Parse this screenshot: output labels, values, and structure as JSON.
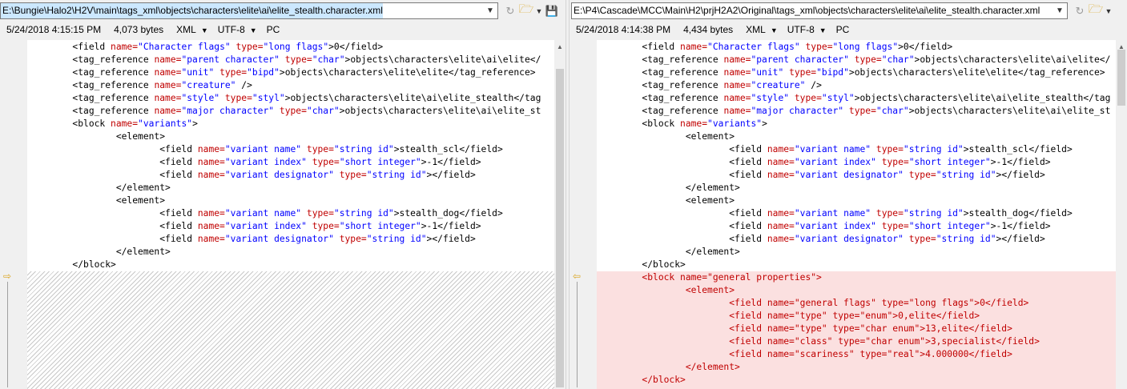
{
  "left": {
    "path": "E:\\Bungie\\Halo2\\H2V\\main\\tags_xml\\objects\\characters\\elite\\ai\\elite_stealth.character.xml",
    "date": "5/24/2018 4:15:15 PM",
    "size": "4,073 bytes",
    "format": "XML",
    "encoding": "UTF-8",
    "line_ending": "PC"
  },
  "right": {
    "path": "E:\\P4\\Cascade\\MCC\\Main\\H2\\prjH2A2\\Original\\tags_xml\\objects\\characters\\elite\\ai\\elite_stealth.character.xml",
    "date": "5/24/2018 4:14:38 PM",
    "size": "4,434 bytes",
    "format": "XML",
    "encoding": "UTF-8",
    "line_ending": "PC"
  },
  "common_lines": [
    [
      {
        "t": "\t<field "
      },
      {
        "a": "name="
      },
      {
        "q": "\"Character flags\""
      },
      {
        "t": " "
      },
      {
        "a": "type="
      },
      {
        "q": "\"long flags\""
      },
      {
        "t": ">0</field>"
      }
    ],
    [
      {
        "t": "\t<tag_reference "
      },
      {
        "a": "name="
      },
      {
        "q": "\"parent character\""
      },
      {
        "t": " "
      },
      {
        "a": "type="
      },
      {
        "q": "\"char\""
      },
      {
        "t": ">objects\\characters\\elite\\ai\\elite</"
      }
    ],
    [
      {
        "t": "\t<tag_reference "
      },
      {
        "a": "name="
      },
      {
        "q": "\"unit\""
      },
      {
        "t": " "
      },
      {
        "a": "type="
      },
      {
        "q": "\"bipd\""
      },
      {
        "t": ">objects\\characters\\elite\\elite</tag_reference>"
      }
    ],
    [
      {
        "t": "\t<tag_reference "
      },
      {
        "a": "name="
      },
      {
        "q": "\"creature\""
      },
      {
        "t": " />"
      }
    ],
    [
      {
        "t": "\t<tag_reference "
      },
      {
        "a": "name="
      },
      {
        "q": "\"style\""
      },
      {
        "t": " "
      },
      {
        "a": "type="
      },
      {
        "q": "\"styl\""
      },
      {
        "t": ">objects\\characters\\elite\\ai\\elite_stealth</tag"
      }
    ],
    [
      {
        "t": "\t<tag_reference "
      },
      {
        "a": "name="
      },
      {
        "q": "\"major character\""
      },
      {
        "t": " "
      },
      {
        "a": "type="
      },
      {
        "q": "\"char\""
      },
      {
        "t": ">objects\\characters\\elite\\ai\\elite_st"
      }
    ],
    [
      {
        "t": "\t<block "
      },
      {
        "a": "name="
      },
      {
        "q": "\"variants\""
      },
      {
        "t": ">"
      }
    ],
    [
      {
        "t": "\t\t<element>"
      }
    ],
    [
      {
        "t": "\t\t\t<field "
      },
      {
        "a": "name="
      },
      {
        "q": "\"variant name\""
      },
      {
        "t": " "
      },
      {
        "a": "type="
      },
      {
        "q": "\"string id\""
      },
      {
        "t": ">stealth_scl</field>"
      }
    ],
    [
      {
        "t": "\t\t\t<field "
      },
      {
        "a": "name="
      },
      {
        "q": "\"variant index\""
      },
      {
        "t": " "
      },
      {
        "a": "type="
      },
      {
        "q": "\"short integer\""
      },
      {
        "t": ">-1</field>"
      }
    ],
    [
      {
        "t": "\t\t\t<field "
      },
      {
        "a": "name="
      },
      {
        "q": "\"variant designator\""
      },
      {
        "t": " "
      },
      {
        "a": "type="
      },
      {
        "q": "\"string id\""
      },
      {
        "t": "></field>"
      }
    ],
    [
      {
        "t": "\t\t</element>"
      }
    ],
    [
      {
        "t": "\t\t<element>"
      }
    ],
    [
      {
        "t": "\t\t\t<field "
      },
      {
        "a": "name="
      },
      {
        "q": "\"variant name\""
      },
      {
        "t": " "
      },
      {
        "a": "type="
      },
      {
        "q": "\"string id\""
      },
      {
        "t": ">stealth_dog</field>"
      }
    ],
    [
      {
        "t": "\t\t\t<field "
      },
      {
        "a": "name="
      },
      {
        "q": "\"variant index\""
      },
      {
        "t": " "
      },
      {
        "a": "type="
      },
      {
        "q": "\"short integer\""
      },
      {
        "t": ">-1</field>"
      }
    ],
    [
      {
        "t": "\t\t\t<field "
      },
      {
        "a": "name="
      },
      {
        "q": "\"variant designator\""
      },
      {
        "t": " "
      },
      {
        "a": "type="
      },
      {
        "q": "\"string id\""
      },
      {
        "t": "></field>"
      }
    ],
    [
      {
        "t": "\t\t</element>"
      }
    ],
    [
      {
        "t": "\t</block>"
      }
    ]
  ],
  "right_added_lines": [
    "\t<block name=\"general properties\">",
    "\t\t<element>",
    "\t\t\t<field name=\"general flags\" type=\"long flags\">0</field>",
    "\t\t\t<field name=\"type\" type=\"enum\">0,elite</field>",
    "\t\t\t<field name=\"type\" type=\"char enum\">13,elite</field>",
    "\t\t\t<field name=\"class\" type=\"char enum\">3,specialist</field>",
    "\t\t\t<field name=\"scariness\" type=\"real\">4.000000</field>",
    "\t\t</element>",
    "\t</block>"
  ],
  "colors": {
    "added_bg": "#fbe0e0",
    "added_text": "#c00000",
    "attr_value": "#0000ff",
    "attr_name": "#c00000",
    "diff_marker": "#d9a520"
  },
  "icons": {
    "left_dropdown": "chevron-down-icon",
    "navigate": "navigate-icon",
    "open_folder": "folder-icon",
    "save": "save-icon",
    "gutter_marker": "diff-arrow-icon"
  }
}
